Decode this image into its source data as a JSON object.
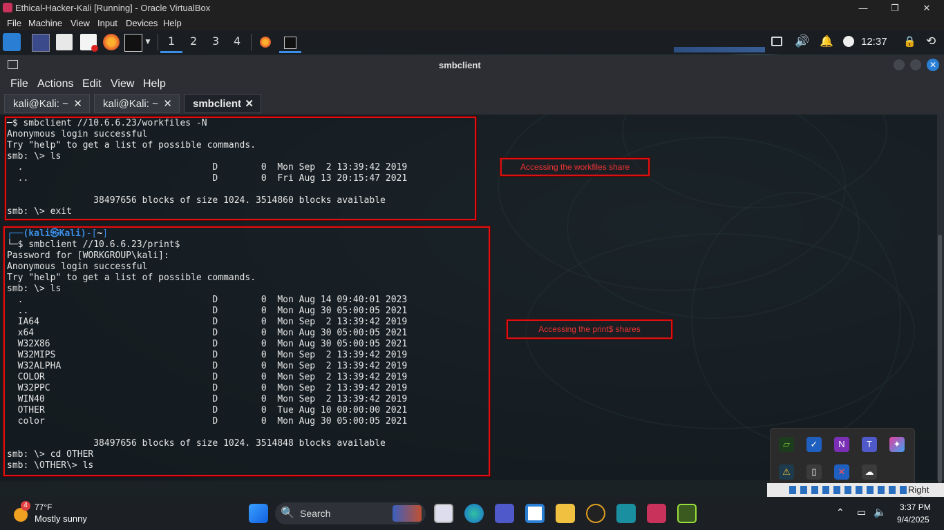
{
  "vbox": {
    "title": "Ethical-Hacker-Kali [Running] - Oracle VirtualBox",
    "menu": [
      "File",
      "Machine",
      "View",
      "Input",
      "Devices",
      "Help"
    ],
    "host_key": "Right Ctrl"
  },
  "kali_panel": {
    "workspaces": [
      "1",
      "2",
      "3",
      "4"
    ],
    "clock": "12:37"
  },
  "terminal": {
    "window_title": "smbclient",
    "menu": [
      "File",
      "Actions",
      "Edit",
      "View",
      "Help"
    ],
    "tabs": [
      {
        "label": "kali@Kali: ~",
        "close": "✕"
      },
      {
        "label": "kali@Kali: ~",
        "close": "✕"
      },
      {
        "label": "smbclient",
        "close": "✕"
      }
    ],
    "block1": [
      "─$ smbclient //10.6.6.23/workfiles -N",
      "Anonymous login successful",
      "Try \"help\" to get a list of possible commands.",
      "smb: \\> ls",
      "  .                                   D        0  Mon Sep  2 13:39:42 2019",
      "  ..                                  D        0  Fri Aug 13 20:15:47 2021",
      "",
      "                38497656 blocks of size 1024. 3514860 blocks available",
      "smb: \\> exit"
    ],
    "prompt_user": "(kali㉿Kali)",
    "prompt_dir": "~",
    "block2": [
      "└─$ smbclient //10.6.6.23/print$",
      "Password for [WORKGROUP\\kali]:",
      "Anonymous login successful",
      "Try \"help\" to get a list of possible commands.",
      "smb: \\> ls",
      "  .                                   D        0  Mon Aug 14 09:40:01 2023",
      "  ..                                  D        0  Mon Aug 30 05:00:05 2021",
      "  IA64                                D        0  Mon Sep  2 13:39:42 2019",
      "  x64                                 D        0  Mon Aug 30 05:00:05 2021",
      "  W32X86                              D        0  Mon Aug 30 05:00:05 2021",
      "  W32MIPS                             D        0  Mon Sep  2 13:39:42 2019",
      "  W32ALPHA                            D        0  Mon Sep  2 13:39:42 2019",
      "  COLOR                               D        0  Mon Sep  2 13:39:42 2019",
      "  W32PPC                              D        0  Mon Sep  2 13:39:42 2019",
      "  WIN40                               D        0  Mon Sep  2 13:39:42 2019",
      "  OTHER                               D        0  Tue Aug 10 00:00:00 2021",
      "  color                               D        0  Mon Aug 30 05:00:05 2021",
      "",
      "                38497656 blocks of size 1024. 3514848 blocks available",
      "smb: \\> cd OTHER",
      "smb: \\OTHER\\> ls"
    ]
  },
  "annotations": {
    "workfiles": "Accessing the workfiles share",
    "print": "Accessing the print$ shares"
  },
  "taskbar": {
    "weather_temp": "77°F",
    "weather_desc": "Mostly sunny",
    "weather_badge": "4",
    "search": "Search",
    "time": "3:37 PM",
    "date": "9/4/2025"
  }
}
